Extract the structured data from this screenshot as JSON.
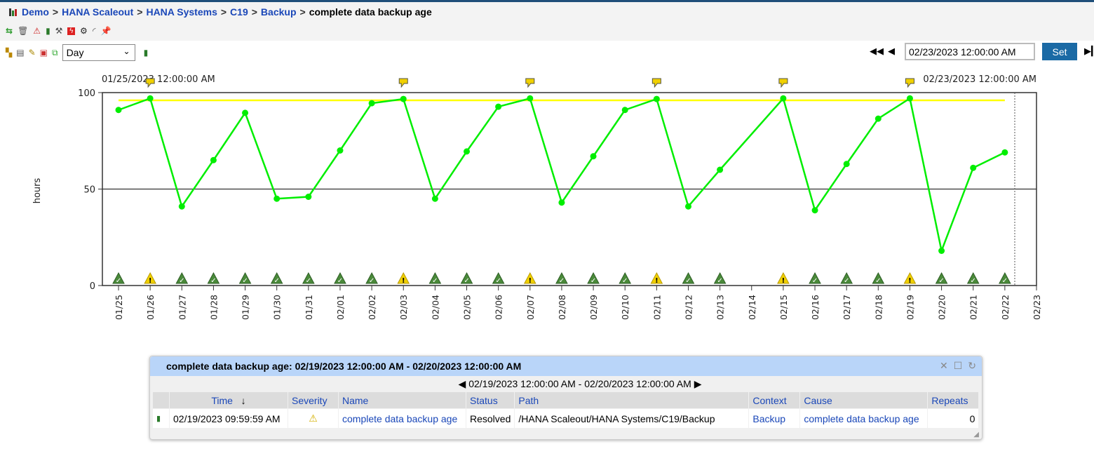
{
  "breadcrumb": {
    "items": [
      "Demo",
      "HANA Scaleout",
      "HANA Systems",
      "C19",
      "Backup"
    ],
    "current": "complete data backup age",
    "separator": ">"
  },
  "toolbar1": {
    "icons": [
      "refresh-icon",
      "trash-icon",
      "alert-config-icon",
      "chart-icon",
      "tools-icon",
      "action-icon",
      "gears-icon",
      "signal-icon",
      "pin-icon"
    ]
  },
  "toolbar2": {
    "icons": [
      "hierarchy-icon",
      "table-icon",
      "edit-icon",
      "report-icon",
      "export-icon"
    ],
    "period": "Day"
  },
  "time_nav": {
    "value": "02/23/2023 12:00:00 AM",
    "set_label": "Set"
  },
  "colors": {
    "line": "#00ee00",
    "threshold": "#ffff00",
    "ok": "#4a8a3a",
    "warning": "#f0d000",
    "header_blue": "#b9d5f9",
    "accent": "#1b6aa5"
  },
  "chart_data": {
    "type": "line",
    "start_label": "01/25/2023 12:00:00 AM",
    "end_label": "02/23/2023 12:00:00 AM",
    "ylabel": "hours",
    "ylim": [
      0,
      100
    ],
    "yticks": [
      "0",
      "50",
      "100"
    ],
    "xticks": [
      "01/25",
      "01/26",
      "01/27",
      "01/28",
      "01/29",
      "01/30",
      "01/31",
      "02/01",
      "02/02",
      "02/03",
      "02/04",
      "02/05",
      "02/06",
      "02/07",
      "02/08",
      "02/09",
      "02/10",
      "02/11",
      "02/12",
      "02/13",
      "02/14",
      "02/15",
      "02/16",
      "02/17",
      "02/18",
      "02/19",
      "02/20",
      "02/21",
      "02/22",
      "02/23"
    ],
    "values": [
      91,
      97,
      41,
      65,
      89.5,
      45,
      46,
      70,
      94.5,
      96.7,
      45,
      69.5,
      92.7,
      97,
      43,
      67,
      91,
      96.7,
      41,
      60,
      null,
      97,
      39,
      63,
      86.5,
      97,
      18,
      61,
      69
    ],
    "threshold": 96,
    "reference_line": 50,
    "status": [
      "ok",
      "warning",
      "ok",
      "ok",
      "ok",
      "ok",
      "ok",
      "ok",
      "ok",
      "warning",
      "ok",
      "ok",
      "ok",
      "warning",
      "ok",
      "ok",
      "ok",
      "warning",
      "ok",
      "ok",
      null,
      "warning",
      "ok",
      "ok",
      "ok",
      "warning",
      "ok",
      "ok",
      "ok"
    ],
    "flags": [
      "01/26",
      "02/03",
      "02/07",
      "02/11",
      "02/15",
      "02/19"
    ]
  },
  "panel": {
    "title": "complete data backup age: 02/19/2023 12:00:00 AM - 02/20/2023 12:00:00 AM",
    "range": "02/19/2023 12:00:00 AM - 02/20/2023 12:00:00 AM",
    "columns": [
      "Time",
      "Severity",
      "Name",
      "Status",
      "Path",
      "Context",
      "Cause",
      "Repeats"
    ],
    "sort_indicator": "↓",
    "rows": [
      {
        "time": "02/19/2023 09:59:59 AM",
        "severity": "warning",
        "name": "complete data backup age",
        "status": "Resolved",
        "path": "/HANA Scaleout/HANA Systems/C19/Backup",
        "context": "Backup",
        "cause": "complete data backup age",
        "repeats": "0"
      }
    ]
  }
}
